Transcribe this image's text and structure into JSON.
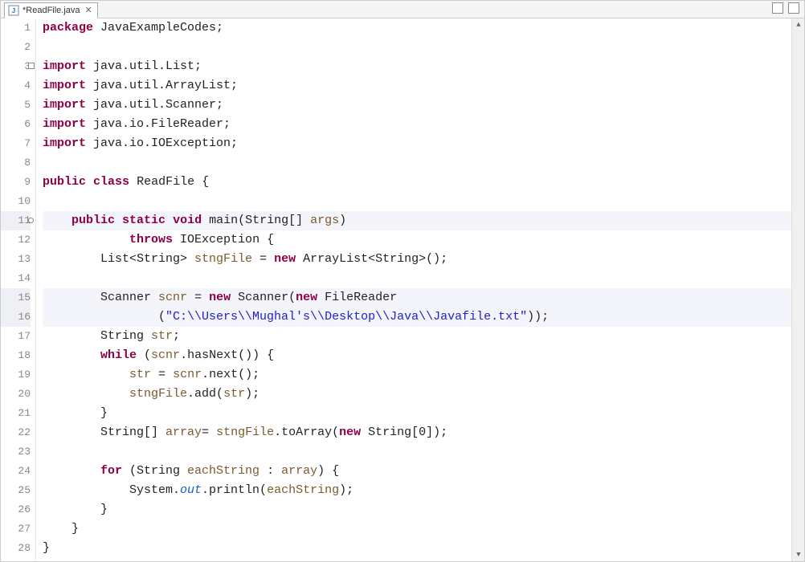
{
  "tab": {
    "label": "*ReadFile.java",
    "icon": "java-file-icon"
  },
  "lines": [
    {
      "n": 1,
      "hl": false,
      "tokens": [
        [
          "kw",
          "package"
        ],
        [
          "",
          ""
        ],
        [
          "pkg",
          " JavaExampleCodes"
        ],
        [
          "",
          ";"
        ]
      ]
    },
    {
      "n": 2,
      "hl": false,
      "tokens": [
        [
          "",
          ""
        ]
      ]
    },
    {
      "n": 3,
      "hl": false,
      "marker": "box",
      "tokens": [
        [
          "kw",
          "import"
        ],
        [
          "",
          " java.util.List;"
        ]
      ]
    },
    {
      "n": 4,
      "hl": false,
      "tokens": [
        [
          "kw",
          "import"
        ],
        [
          "",
          " java.util.ArrayList;"
        ]
      ]
    },
    {
      "n": 5,
      "hl": false,
      "tokens": [
        [
          "kw",
          "import"
        ],
        [
          "",
          " java.util.Scanner;"
        ]
      ]
    },
    {
      "n": 6,
      "hl": false,
      "tokens": [
        [
          "kw",
          "import"
        ],
        [
          "",
          " java.io.FileReader;"
        ]
      ]
    },
    {
      "n": 7,
      "hl": false,
      "tokens": [
        [
          "kw",
          "import"
        ],
        [
          "",
          " java.io.IOException;"
        ]
      ]
    },
    {
      "n": 8,
      "hl": false,
      "tokens": [
        [
          "",
          ""
        ]
      ]
    },
    {
      "n": 9,
      "hl": false,
      "tokens": [
        [
          "kw",
          "public"
        ],
        [
          "",
          " "
        ],
        [
          "kw",
          "class"
        ],
        [
          "",
          " "
        ],
        [
          "cls",
          "ReadFile"
        ],
        [
          "",
          " {"
        ]
      ]
    },
    {
      "n": 10,
      "hl": false,
      "tokens": [
        [
          "",
          ""
        ]
      ]
    },
    {
      "n": 11,
      "hl": true,
      "marker": "circle",
      "tokens": [
        [
          "",
          "    "
        ],
        [
          "kw",
          "public"
        ],
        [
          "",
          " "
        ],
        [
          "kw",
          "static"
        ],
        [
          "",
          " "
        ],
        [
          "kw",
          "void"
        ],
        [
          "",
          " main(String[] "
        ],
        [
          "var",
          "args"
        ],
        [
          "",
          ")"
        ]
      ]
    },
    {
      "n": 12,
      "hl": false,
      "tokens": [
        [
          "",
          "            "
        ],
        [
          "kw",
          "throws"
        ],
        [
          "",
          " IOException {"
        ]
      ]
    },
    {
      "n": 13,
      "hl": false,
      "tokens": [
        [
          "",
          "        List<String> "
        ],
        [
          "var",
          "stngFile"
        ],
        [
          "",
          " = "
        ],
        [
          "kw",
          "new"
        ],
        [
          "",
          " ArrayList<String>();"
        ]
      ]
    },
    {
      "n": 14,
      "hl": false,
      "tokens": [
        [
          "",
          ""
        ]
      ]
    },
    {
      "n": 15,
      "hl": true,
      "tokens": [
        [
          "",
          "        Scanner "
        ],
        [
          "var",
          "scnr"
        ],
        [
          "",
          " = "
        ],
        [
          "kw",
          "new"
        ],
        [
          "",
          " Scanner("
        ],
        [
          "kw",
          "new"
        ],
        [
          "",
          " FileReader"
        ]
      ]
    },
    {
      "n": 16,
      "hl": true,
      "tokens": [
        [
          "",
          "                ("
        ],
        [
          "str",
          "\"C:\\\\Users\\\\Mughal's\\\\Desktop\\\\Java\\\\Javafile.txt\""
        ],
        [
          "",
          "));"
        ]
      ]
    },
    {
      "n": 17,
      "hl": false,
      "tokens": [
        [
          "",
          "        String "
        ],
        [
          "var",
          "str"
        ],
        [
          "",
          ";"
        ]
      ]
    },
    {
      "n": 18,
      "hl": false,
      "tokens": [
        [
          "",
          "        "
        ],
        [
          "kw",
          "while"
        ],
        [
          "",
          " ("
        ],
        [
          "var",
          "scnr"
        ],
        [
          "",
          ".hasNext()) {"
        ]
      ]
    },
    {
      "n": 19,
      "hl": false,
      "tokens": [
        [
          "",
          "            "
        ],
        [
          "var",
          "str"
        ],
        [
          "",
          " = "
        ],
        [
          "var",
          "scnr"
        ],
        [
          "",
          ".next();"
        ]
      ]
    },
    {
      "n": 20,
      "hl": false,
      "tokens": [
        [
          "",
          "            "
        ],
        [
          "var",
          "stngFile"
        ],
        [
          "",
          ".add("
        ],
        [
          "var",
          "str"
        ],
        [
          "",
          ");"
        ]
      ]
    },
    {
      "n": 21,
      "hl": false,
      "tokens": [
        [
          "",
          "        }"
        ]
      ]
    },
    {
      "n": 22,
      "hl": false,
      "tokens": [
        [
          "",
          "        String[] "
        ],
        [
          "var",
          "array"
        ],
        [
          "",
          "= "
        ],
        [
          "var",
          "stngFile"
        ],
        [
          "",
          ".toArray("
        ],
        [
          "kw",
          "new"
        ],
        [
          "",
          " String[0]);"
        ]
      ]
    },
    {
      "n": 23,
      "hl": false,
      "tokens": [
        [
          "",
          ""
        ]
      ]
    },
    {
      "n": 24,
      "hl": false,
      "tokens": [
        [
          "",
          "        "
        ],
        [
          "kw",
          "for"
        ],
        [
          "",
          " (String "
        ],
        [
          "var",
          "eachString"
        ],
        [
          "",
          " : "
        ],
        [
          "var",
          "array"
        ],
        [
          "",
          ") {"
        ]
      ]
    },
    {
      "n": 25,
      "hl": false,
      "tokens": [
        [
          "",
          "            System."
        ],
        [
          "stat",
          "out"
        ],
        [
          "",
          ".println("
        ],
        [
          "var",
          "eachString"
        ],
        [
          "",
          ");"
        ]
      ]
    },
    {
      "n": 26,
      "hl": false,
      "tokens": [
        [
          "",
          "        }"
        ]
      ]
    },
    {
      "n": 27,
      "hl": false,
      "tokens": [
        [
          "",
          "    }"
        ]
      ]
    },
    {
      "n": 28,
      "hl": false,
      "tokens": [
        [
          "",
          "}"
        ]
      ]
    }
  ]
}
